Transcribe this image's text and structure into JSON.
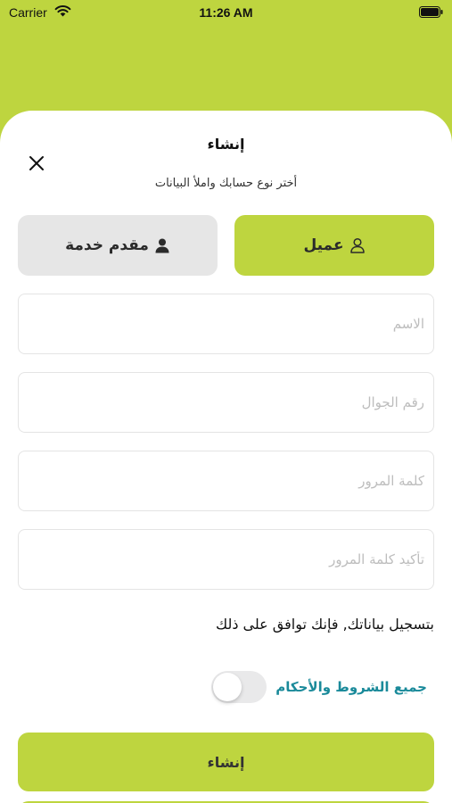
{
  "status_bar": {
    "carrier": "Carrier",
    "time": "11:26 AM"
  },
  "sheet": {
    "title": "إنشاء",
    "subtitle": "أختر نوع حسابك واملأ البيانات",
    "close_icon": "close-icon"
  },
  "account_types": {
    "client": {
      "label": "عميل",
      "icon": "user-outline-icon",
      "selected": true
    },
    "provider": {
      "label": "مقدم خدمة",
      "icon": "user-filled-icon",
      "selected": false
    }
  },
  "form": {
    "name_placeholder": "الاسم",
    "phone_placeholder": "رقم الجوال",
    "password_placeholder": "كلمة المرور",
    "confirm_password_placeholder": "تأكيد كلمة المرور"
  },
  "agreement": {
    "text": "بتسجيل بياناتك, فإنك توافق على ذلك",
    "terms_label": "جميع الشروط والأحكام",
    "toggle_on": false
  },
  "submit": {
    "label": "إنشاء"
  },
  "colors": {
    "accent": "#bed53f",
    "link": "#1a8a9a",
    "secondary_button": "#e6e6e6"
  }
}
